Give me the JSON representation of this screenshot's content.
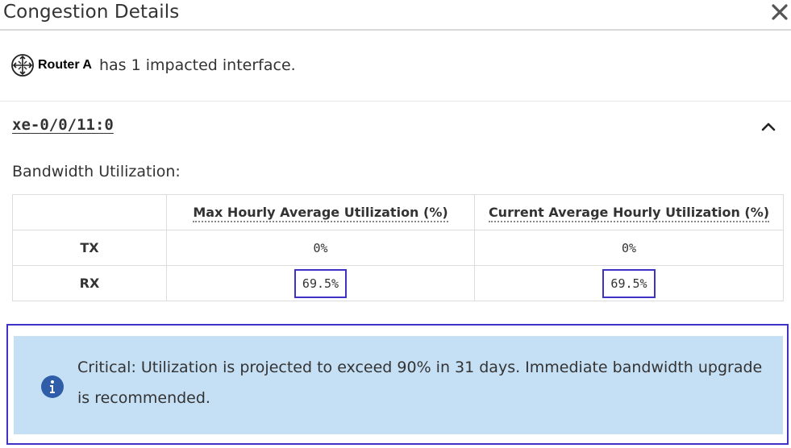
{
  "dialog": {
    "title": "Congestion Details",
    "close_icon": "close-icon"
  },
  "summary": {
    "router_icon": "router-icon",
    "router_name": "Router A",
    "text": "has 1 impacted interface."
  },
  "interface": {
    "name": "xe-0/0/11:0",
    "expanded": true,
    "toggle_icon": "chevron-up-icon"
  },
  "bandwidth": {
    "title": "Bandwidth Utilization:",
    "columns": [
      "",
      "Max Hourly Average Utilization (%)",
      "Current Average Hourly Utilization (%)"
    ],
    "rows": [
      {
        "label": "TX",
        "max": "0%",
        "current": "0%"
      },
      {
        "label": "RX",
        "max": "69.5%",
        "current": "69.5%"
      }
    ]
  },
  "alert": {
    "icon": "info-icon",
    "message": "Critical: Utilization is projected to exceed 90% in 31 days. Immediate bandwidth upgrade is recommended.",
    "background_color": "#c5dff4"
  },
  "colors": {
    "highlight": "#3f33c6",
    "text": "#333333"
  }
}
